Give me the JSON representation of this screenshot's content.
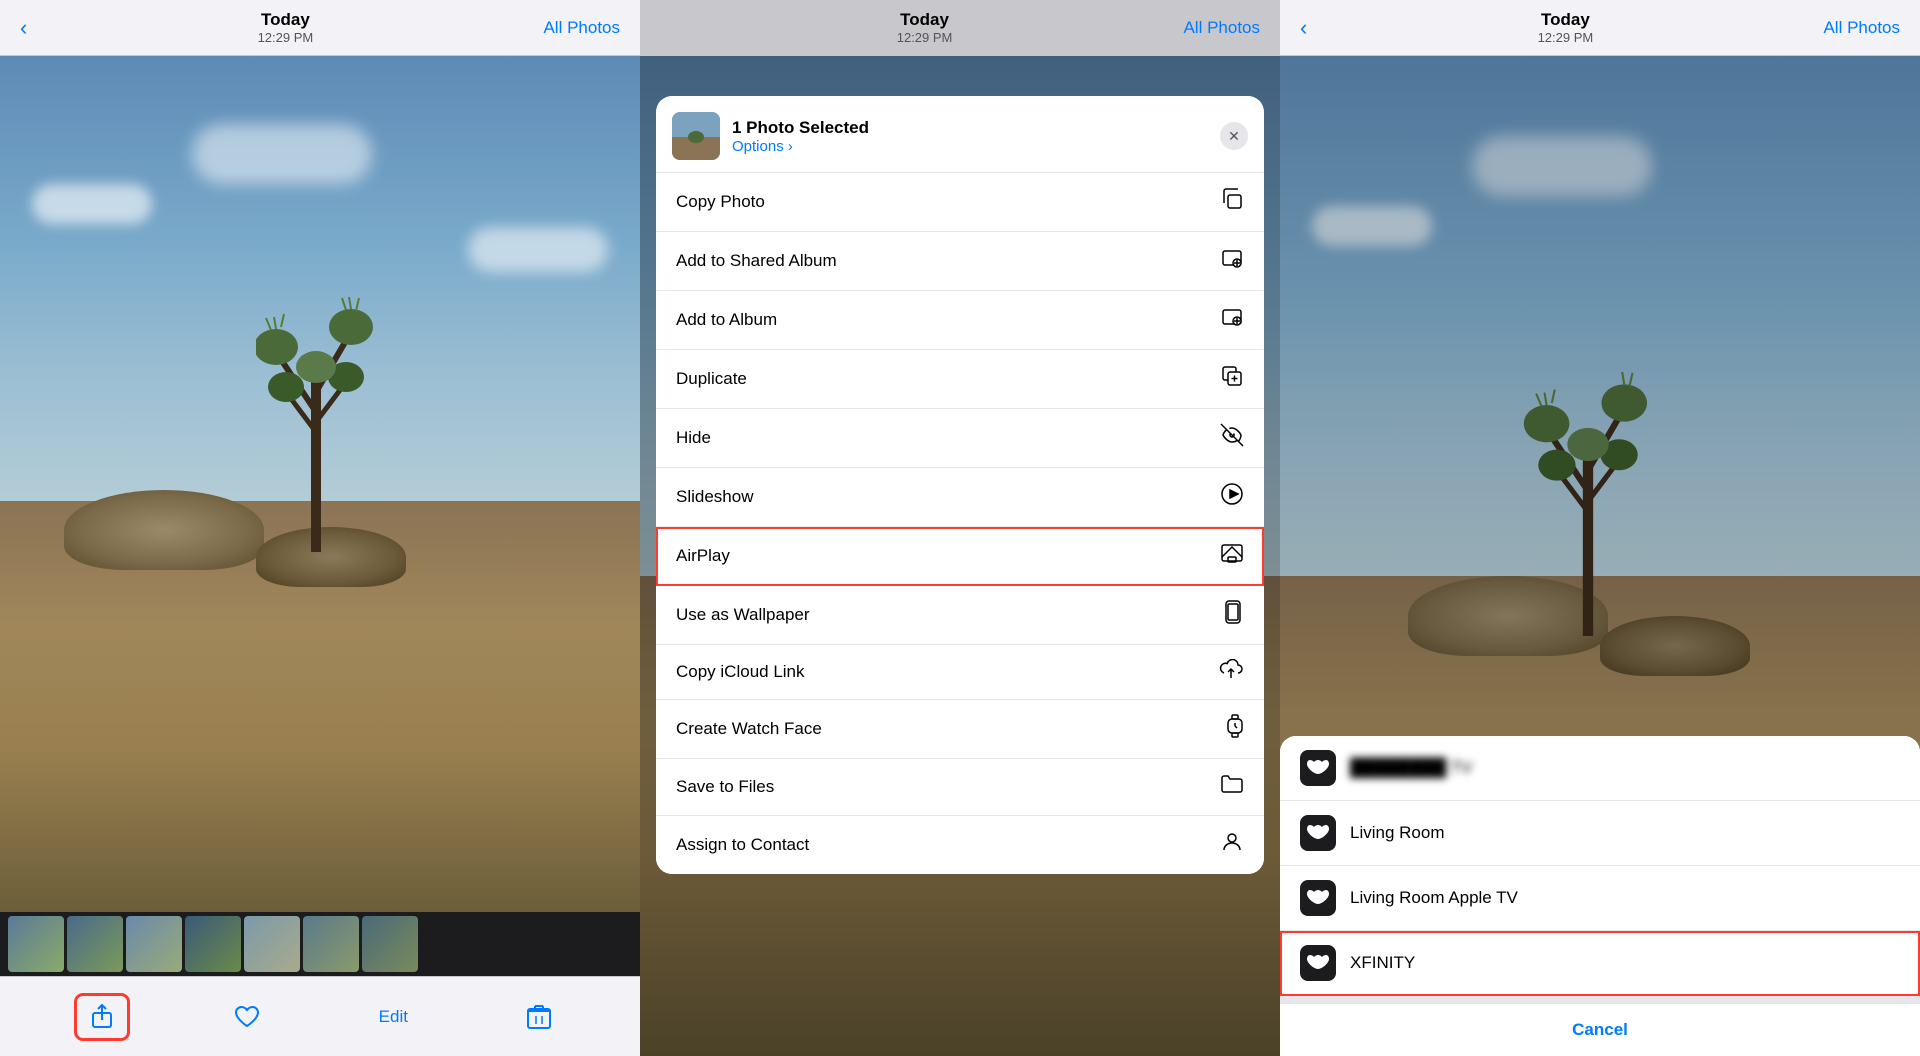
{
  "panels": {
    "left": {
      "nav": {
        "back_label": "‹",
        "title": "Today",
        "subtitle": "12:29 PM",
        "action_label": "All Photos"
      },
      "toolbar": {
        "share_label": "⬆",
        "like_label": "♡",
        "edit_label": "Edit",
        "delete_label": "🗑"
      }
    },
    "center": {
      "nav": {
        "title": "Today",
        "subtitle": "12:29 PM",
        "action_label": "All Photos"
      },
      "share_sheet": {
        "header": {
          "title": "1 Photo Selected",
          "options_label": "Options ›",
          "close_label": "✕"
        },
        "items": [
          {
            "id": "copy-photo",
            "label": "Copy Photo",
            "icon": "📋",
            "highlighted": false
          },
          {
            "id": "add-shared-album",
            "label": "Add to Shared Album",
            "icon": "👥",
            "highlighted": false
          },
          {
            "id": "add-album",
            "label": "Add to Album",
            "icon": "📚",
            "highlighted": false
          },
          {
            "id": "duplicate",
            "label": "Duplicate",
            "icon": "⊕",
            "highlighted": false
          },
          {
            "id": "hide",
            "label": "Hide",
            "icon": "👁",
            "highlighted": false
          },
          {
            "id": "slideshow",
            "label": "Slideshow",
            "icon": "▶",
            "highlighted": false
          },
          {
            "id": "airplay",
            "label": "AirPlay",
            "icon": "⬆",
            "highlighted": true
          },
          {
            "id": "wallpaper",
            "label": "Use as Wallpaper",
            "icon": "📱",
            "highlighted": false
          },
          {
            "id": "icloud-link",
            "label": "Copy iCloud Link",
            "icon": "☁",
            "highlighted": false
          },
          {
            "id": "watch-face",
            "label": "Create Watch Face",
            "icon": "⌚",
            "highlighted": false
          },
          {
            "id": "save-files",
            "label": "Save to Files",
            "icon": "📁",
            "highlighted": false
          },
          {
            "id": "assign-contact",
            "label": "Assign to Contact",
            "icon": "👤",
            "highlighted": false
          }
        ]
      }
    },
    "right": {
      "nav": {
        "back_label": "‹",
        "title": "Today",
        "subtitle": "12:29 PM",
        "action_label": "All Photos"
      },
      "airplay": {
        "devices": [
          {
            "id": "device-1",
            "name": "TV",
            "name_blurred": true,
            "highlighted": false
          },
          {
            "id": "device-2",
            "name": "Living Room",
            "name_blurred": false,
            "highlighted": false
          },
          {
            "id": "device-3",
            "name": "Living Room Apple TV",
            "name_blurred": false,
            "highlighted": false
          },
          {
            "id": "device-4",
            "name": "XFINITY",
            "name_blurred": false,
            "highlighted": true
          }
        ],
        "cancel_label": "Cancel"
      }
    }
  }
}
